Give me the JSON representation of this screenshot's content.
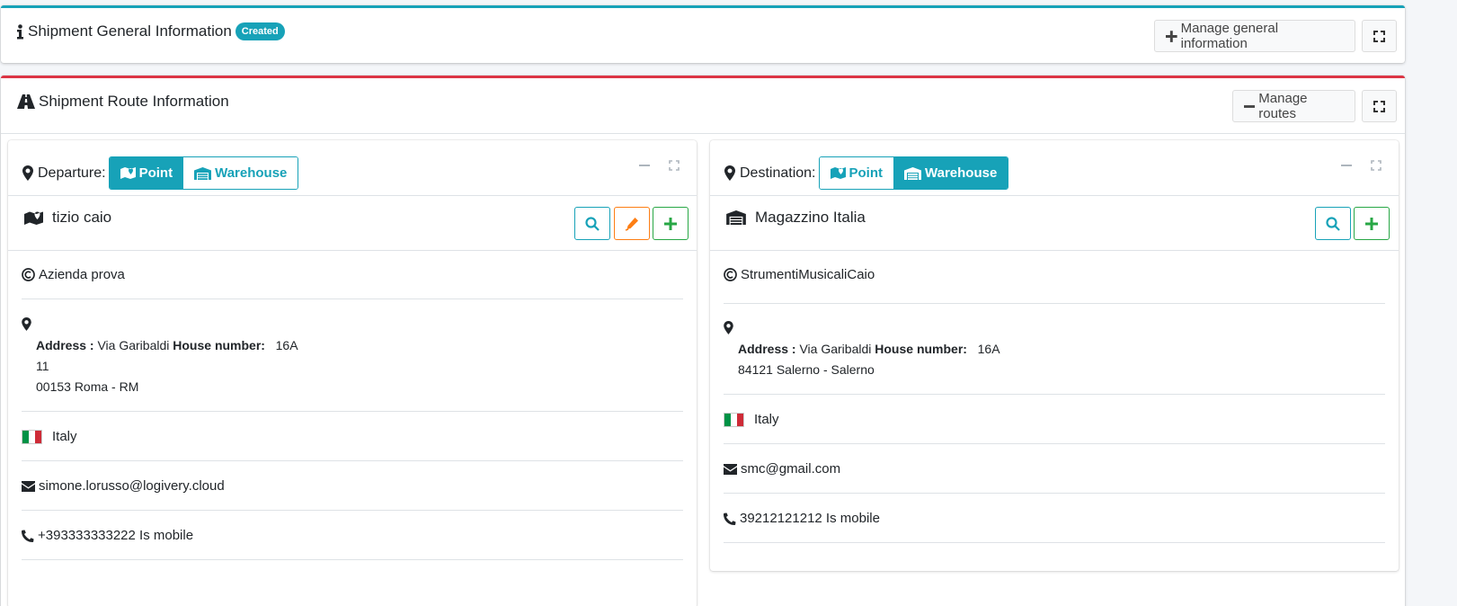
{
  "general": {
    "title": "Shipment General Information",
    "status_badge": "Created",
    "manage_label": "Manage general information"
  },
  "route": {
    "title": "Shipment Route Information",
    "manage_label": "Manage routes"
  },
  "departure": {
    "label": "Departure:",
    "toggle": {
      "point": "Point",
      "warehouse": "Warehouse",
      "active": "point"
    },
    "name": "tizio caio",
    "company": "Azienda prova",
    "address_label": "Address :",
    "street": "Via Garibaldi",
    "house_number_label": "House number:",
    "house_number": "16A",
    "extra": "11",
    "city_line": "00153 Roma - RM",
    "country": "Italy",
    "email": "simone.lorusso@logivery.cloud",
    "phone": "+393333333222 Is mobile"
  },
  "destination": {
    "label": "Destination:",
    "toggle": {
      "point": "Point",
      "warehouse": "Warehouse",
      "active": "warehouse"
    },
    "name": "Magazzino Italia",
    "company": "StrumentiMusicaliCaio",
    "address_label": "Address :",
    "street": "Via Garibaldi",
    "house_number_label": "House number:",
    "house_number": "16A",
    "city_line": "84121 Salerno - Salerno",
    "country": "Italy",
    "email": "smc@gmail.com",
    "phone": "39212121212 Is mobile"
  },
  "colors": {
    "info": "#17a2b8",
    "danger": "#dc3545",
    "warning": "#fd7e14",
    "success": "#28a745",
    "flag_green": "#009246",
    "flag_white": "#ffffff",
    "flag_red": "#ce2b37"
  },
  "icons": {
    "general": "info-icon",
    "route": "road-icon",
    "departure": "map-marker-icon",
    "point": "map-icon",
    "warehouse": "warehouse-icon",
    "company": "copyright-icon",
    "email": "envelope-icon",
    "phone": "phone-icon",
    "search": "search-icon",
    "edit": "pencil-icon",
    "add": "plus-icon",
    "expand": "expand-icon",
    "collapse": "minus-icon"
  }
}
